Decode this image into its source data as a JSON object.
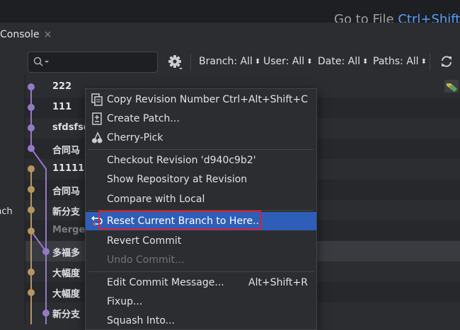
{
  "header": {
    "goto_label": "Go to File",
    "goto_shortcut": "Ctrl+Shift"
  },
  "tab": {
    "title": "Console",
    "close": "×"
  },
  "toolbar": {
    "filters": [
      {
        "label": "Branch: All"
      },
      {
        "label": "User: All"
      },
      {
        "label": "Date: All"
      },
      {
        "label": "Paths: All"
      }
    ]
  },
  "left_pane": {
    "label": "nch"
  },
  "commits": [
    {
      "message": "222",
      "node": "purple"
    },
    {
      "message": "111",
      "node": "purple"
    },
    {
      "message": "sfdsfsd",
      "node": "purple"
    },
    {
      "message": "合同马",
      "node": "purple"
    },
    {
      "message": "11111",
      "node": "gold"
    },
    {
      "message": "合同马",
      "node": "gold"
    },
    {
      "message": "新分支",
      "node": "gold"
    },
    {
      "message": "Merge",
      "node": "gold"
    },
    {
      "message": "多福多",
      "node": "purple"
    },
    {
      "message": "大幅度",
      "node": "gold"
    },
    {
      "message": "大幅度",
      "node": "gold"
    },
    {
      "message": "新分支",
      "node": "purple"
    }
  ],
  "context_menu": {
    "items": [
      {
        "label": "Copy Revision Number",
        "shortcut": "Ctrl+Alt+Shift+C",
        "icon": "copy-icon"
      },
      {
        "label": "Create Patch...",
        "icon": "patch-icon"
      },
      {
        "label": "Cherry-Pick",
        "icon": "cherry-icon"
      },
      {
        "label": "Checkout Revision 'd940c9b2'"
      },
      {
        "label": "Show Repository at Revision"
      },
      {
        "label": "Compare with Local"
      },
      {
        "label": "Reset Current Branch to Here...",
        "icon": "reset-icon",
        "highlighted": true
      },
      {
        "label": "Revert Commit"
      },
      {
        "label": "Undo Commit...",
        "disabled": true
      },
      {
        "label": "Edit Commit Message...",
        "shortcut": "Alt+Shift+R"
      },
      {
        "label": "Fixup..."
      },
      {
        "label": "Squash Into..."
      }
    ]
  },
  "colors": {
    "accent": "#2e5eb8",
    "branch_purple": "#9678c8",
    "branch_gold": "#b9955c",
    "annotation_red": "#e0202a"
  }
}
